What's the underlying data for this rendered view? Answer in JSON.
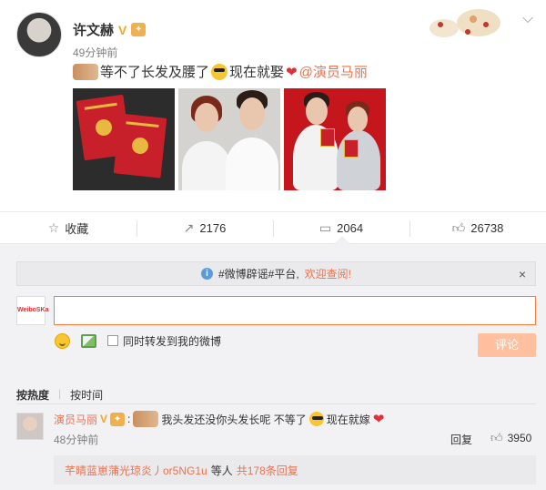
{
  "post": {
    "author": "许文赫",
    "verified_mark": "V",
    "time": "49分钟前",
    "text_part1": "等不了长发及腰了",
    "text_part2": "现在就娶",
    "heart": "❤",
    "mention": "@演员马丽"
  },
  "actions": {
    "favorite_label": "收藏",
    "repost_count": "2176",
    "comment_count": "2064",
    "like_count": "26738"
  },
  "notice": {
    "text_before": "#微博辟谣#平台,",
    "text_highlight": "欢迎查阅!",
    "close": "×"
  },
  "composer": {
    "avatar_text": "WeiboSKa",
    "input_value": "",
    "repost_label": "同时转发到我的微博",
    "submit_label": "评论"
  },
  "sort": {
    "by_hot": "按热度",
    "by_time": "按时间"
  },
  "comment": {
    "name": "演员马丽",
    "verified_mark": "V",
    "text": "我头发还没你头发长呢 不等了",
    "text_after": "现在就嫁",
    "heart": "❤",
    "time": "48分钟前",
    "reply_label": "回复",
    "like_count": "3950",
    "sub_users": "芊晴蓝崽蒲光琼炎丿or5NG1u",
    "sub_suffix": "等人",
    "sub_count": "共178条回复"
  },
  "colors": {
    "accent": "#eb7350",
    "input_border": "#fa7d3c",
    "button_disabled": "#ffc09f",
    "verified": "#f5a623"
  }
}
